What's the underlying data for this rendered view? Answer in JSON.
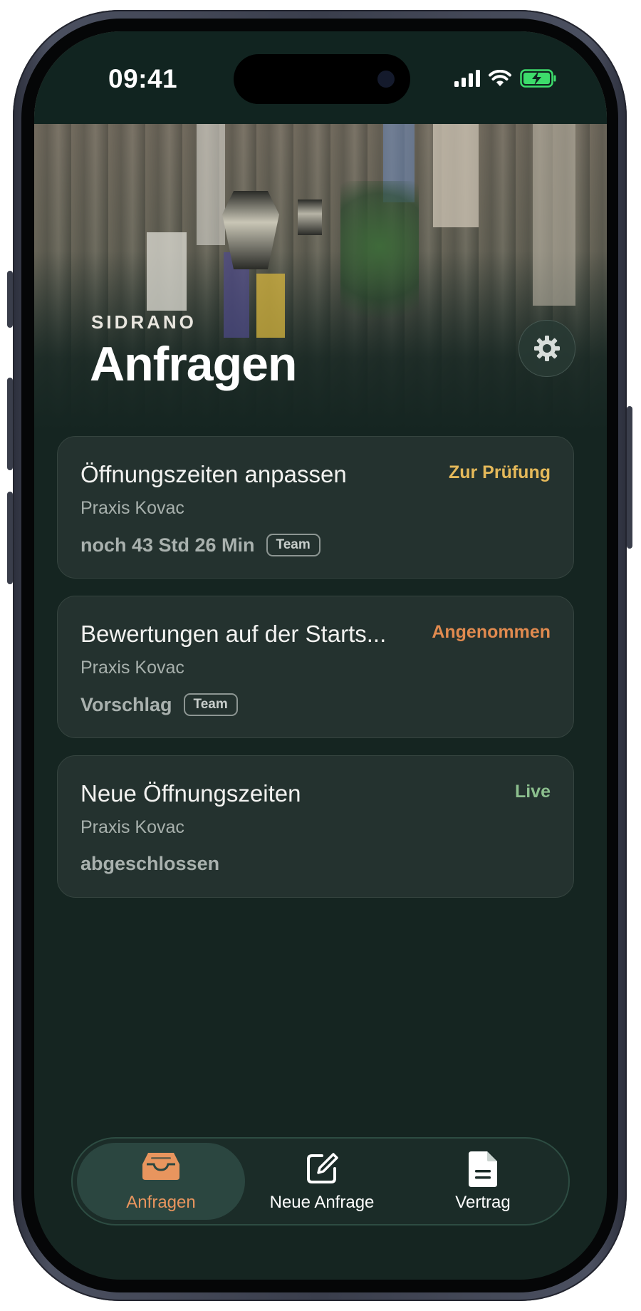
{
  "status_bar": {
    "time": "09:41",
    "battery_color": "#3ddc6b"
  },
  "header": {
    "brand": "SIDRANO",
    "title": "Anfragen",
    "settings_icon": "gear-icon"
  },
  "requests": [
    {
      "title": "Öffnungszeiten anpassen",
      "status": "Zur Prüfung",
      "status_color": "#e5b95a",
      "client": "Praxis Kovac",
      "meta": "noch 43 Std 26 Min",
      "badge": "Team"
    },
    {
      "title": "Bewertungen auf der Starts...",
      "status": "Angenommen",
      "status_color": "#e08a4f",
      "client": "Praxis Kovac",
      "meta": "Vorschlag",
      "badge": "Team"
    },
    {
      "title": "Neue Öffnungszeiten",
      "status": "Live",
      "status_color": "#8cbf8e",
      "client": "Praxis Kovac",
      "meta": "abgeschlossen",
      "badge": ""
    }
  ],
  "tabbar": {
    "accent": "#e8955e",
    "tabs": [
      {
        "label": "Anfragen",
        "icon": "inbox-tray-icon",
        "active": true
      },
      {
        "label": "Neue Anfrage",
        "icon": "compose-icon",
        "active": false
      },
      {
        "label": "Vertrag",
        "icon": "document-icon",
        "active": false
      }
    ]
  }
}
